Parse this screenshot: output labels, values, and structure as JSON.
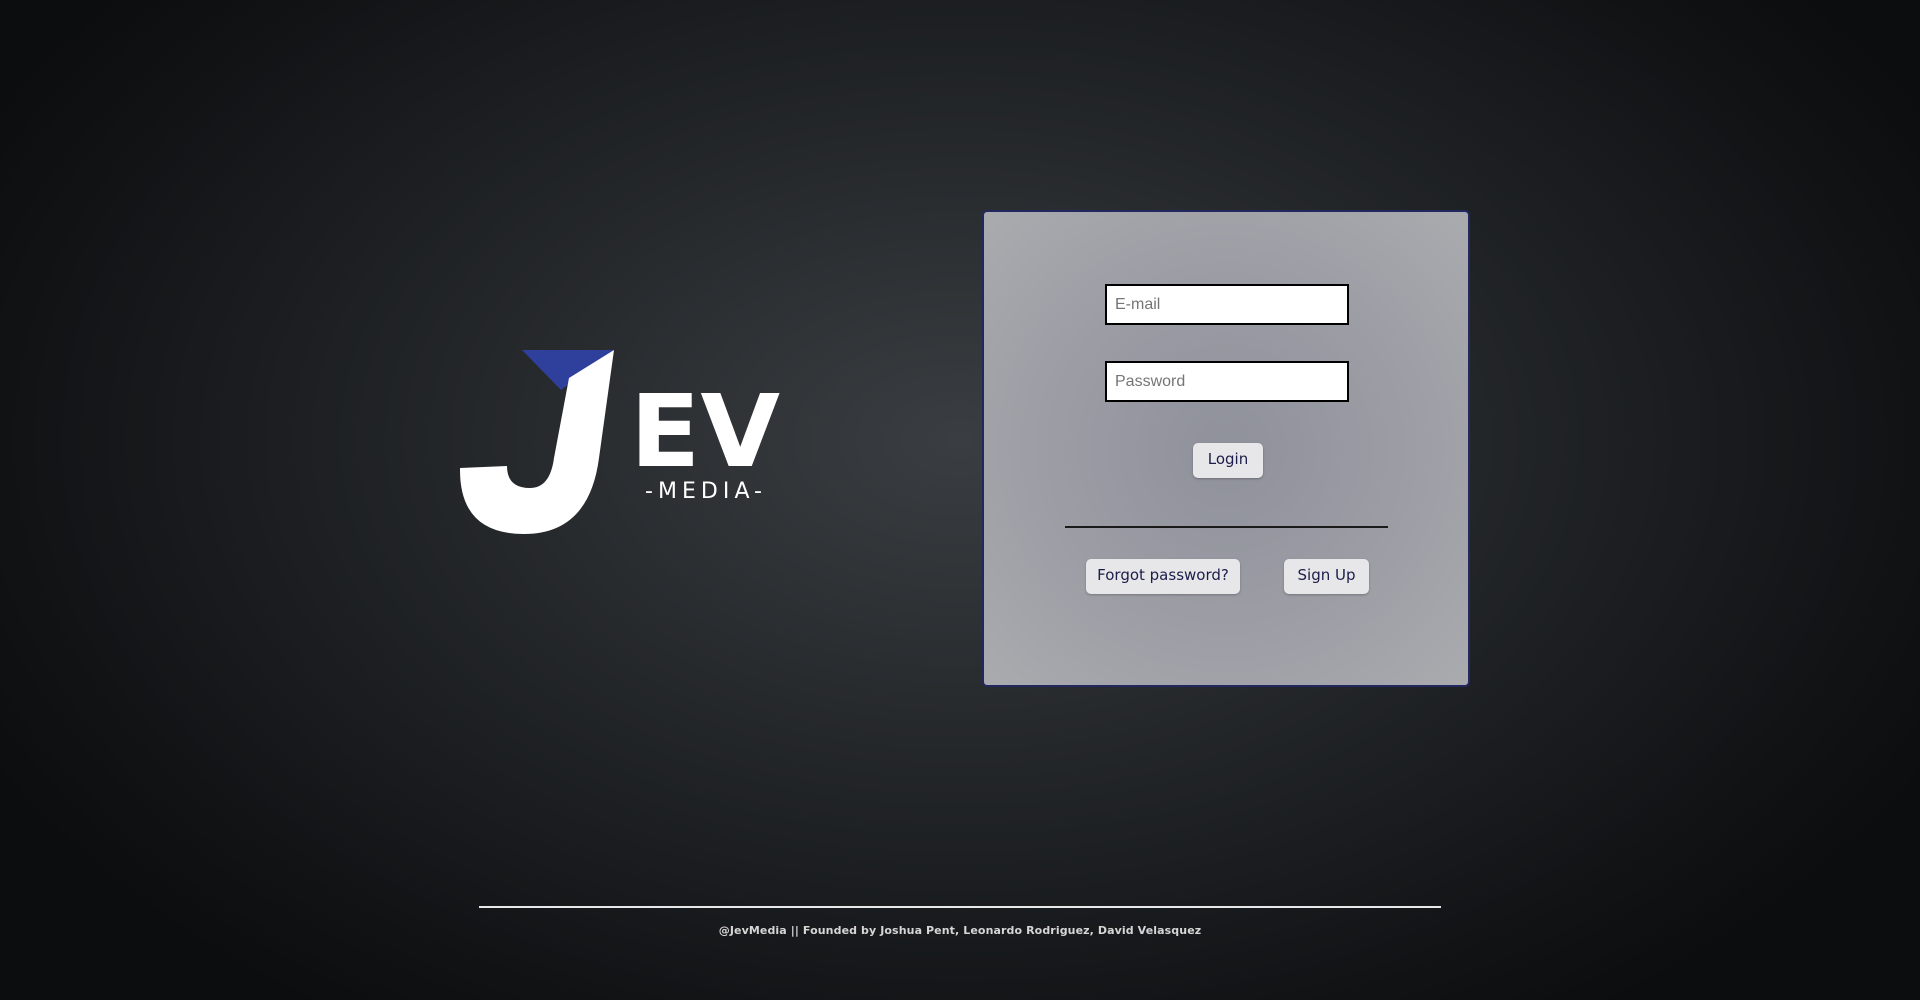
{
  "logo": {
    "wordmark": "EV",
    "letter": "J",
    "tagline": "-MEDIA-",
    "accent_color": "#2f3f9c",
    "fill_color": "#ffffff"
  },
  "login_form": {
    "email_placeholder": "E-mail",
    "password_placeholder": "Password",
    "login_label": "Login",
    "forgot_label": "Forgot password?",
    "signup_label": "Sign Up",
    "border_color": "#232760"
  },
  "footer": {
    "text": "@JevMedia || Founded by Joshua Pent, Leonardo Rodriguez, David Velasquez"
  }
}
